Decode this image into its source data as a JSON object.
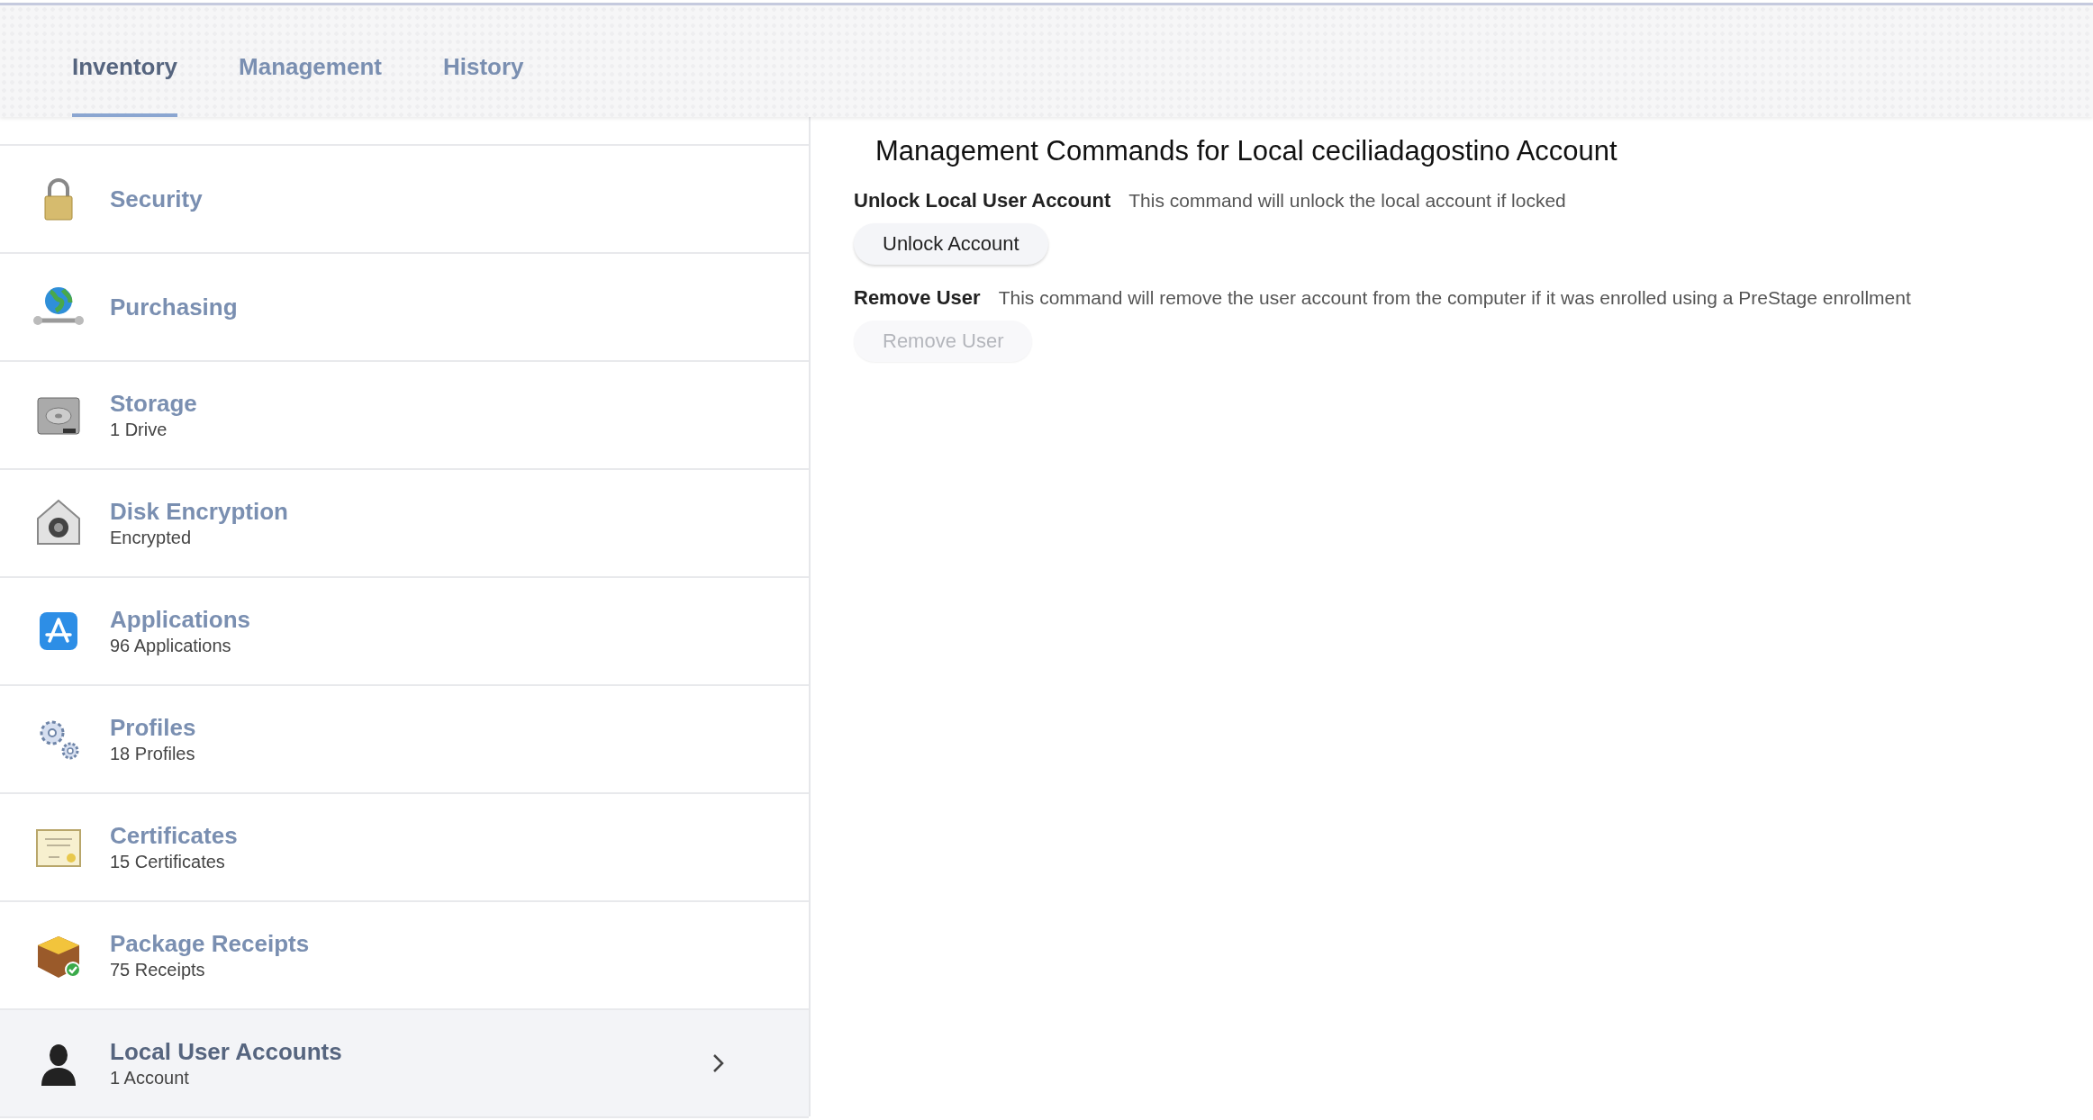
{
  "tabs": [
    {
      "label": "Inventory",
      "selected": true
    },
    {
      "label": "Management",
      "selected": false
    },
    {
      "label": "History",
      "selected": false
    }
  ],
  "sidebar": {
    "items": [
      {
        "kind": "lock",
        "title": "Security",
        "selected": false
      },
      {
        "kind": "globe",
        "title": "Purchasing",
        "selected": false
      },
      {
        "kind": "drive",
        "title": "Storage",
        "subtitle": "1 Drive",
        "selected": false
      },
      {
        "kind": "vault",
        "title": "Disk Encryption",
        "subtitle": "Encrypted",
        "selected": false
      },
      {
        "kind": "appstore",
        "title": "Applications",
        "subtitle": "96 Applications",
        "selected": false
      },
      {
        "kind": "gears",
        "title": "Profiles",
        "subtitle": "18 Profiles",
        "selected": false
      },
      {
        "kind": "certificate",
        "title": "Certificates",
        "subtitle": "15 Certificates",
        "selected": false
      },
      {
        "kind": "package",
        "title": "Package Receipts",
        "subtitle": "75 Receipts",
        "selected": false
      },
      {
        "kind": "user",
        "title": "Local User Accounts",
        "subtitle": "1 Account",
        "selected": true
      }
    ]
  },
  "panel": {
    "title": "Management Commands for Local ceciliadagostino Account",
    "commands": [
      {
        "label": "Unlock Local User Account",
        "description": "This command will unlock the local account if locked",
        "button": "Unlock Account",
        "disabled": false
      },
      {
        "label": "Remove User",
        "description": "This command will remove the user account from the computer if it was enrolled using a PreStage enrollment",
        "button": "Remove User",
        "disabled": true
      }
    ]
  }
}
